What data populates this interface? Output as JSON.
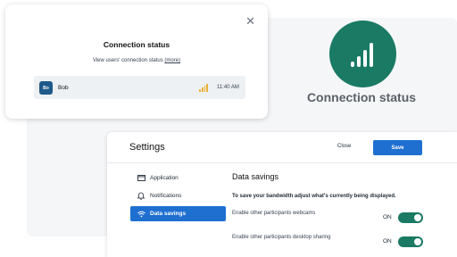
{
  "popup": {
    "title": "Connection status",
    "subtitle": "View users' connection status",
    "more_link": "(more)",
    "close_icon": "close-icon",
    "user": {
      "initials": "Bo",
      "name": "Bob",
      "time": "11:40 AM",
      "signal_color": "#e8b23a"
    }
  },
  "hero": {
    "title": "Connection status",
    "icon": "signal-bars-icon",
    "color": "#1a7a64"
  },
  "settings": {
    "title": "Settings",
    "close_label": "Close",
    "save_label": "Save",
    "menu": [
      {
        "label": "Application",
        "icon": "window-icon",
        "active": false
      },
      {
        "label": "Notifications",
        "icon": "bell-icon",
        "active": false
      },
      {
        "label": "Data savings",
        "icon": "wifi-icon",
        "active": true
      }
    ],
    "section_title": "Data savings",
    "section_desc": "To save your bandwidth adjust what's currently being displayed.",
    "options": [
      {
        "label": "Enable other participants webcams",
        "state": "ON",
        "enabled": true
      },
      {
        "label": "Enable other participants desktop sharing",
        "state": "ON",
        "enabled": true
      }
    ],
    "accent": "#1f6fd1",
    "toggle_color": "#1a7a64"
  }
}
